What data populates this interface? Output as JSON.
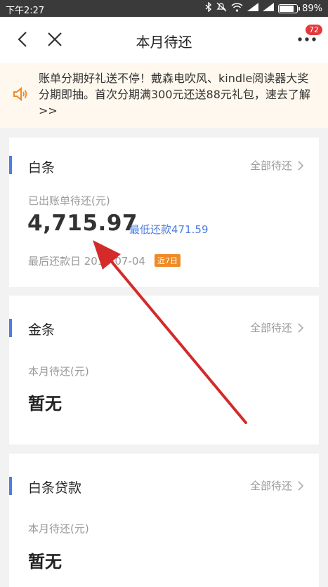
{
  "status_bar": {
    "time": "下午2:27",
    "battery_percent_label": "89%",
    "battery_level": 0.89
  },
  "nav": {
    "title": "本月待还",
    "message_badge": "72"
  },
  "notice": {
    "text": "账单分期好礼送不停！戴森电吹风、kindle阅读器大奖分期即抽。首次分期满300元还送88元礼包，速去了解>>"
  },
  "cards": {
    "baitiao": {
      "title": "白条",
      "more_label": "全部待还",
      "amount_label": "已出账单待还(元)",
      "amount": "4,715.97",
      "min_payment": "最低还款471.59",
      "due_label": "最后还款日 2018-07-04",
      "due_tag": "近7日"
    },
    "jintiao": {
      "title": "金条",
      "more_label": "全部待还",
      "amount_label": "本月待还(元)",
      "amount": "暂无"
    },
    "baitiao_loan": {
      "title": "白条贷款",
      "more_label": "全部待还",
      "amount_label": "本月待还(元)",
      "amount": "暂无"
    }
  },
  "colors": {
    "accent_blue": "#4e7de0",
    "annotation_red": "#d42a2a",
    "tag_orange": "#f08a24",
    "badge_red": "#e4393c"
  }
}
